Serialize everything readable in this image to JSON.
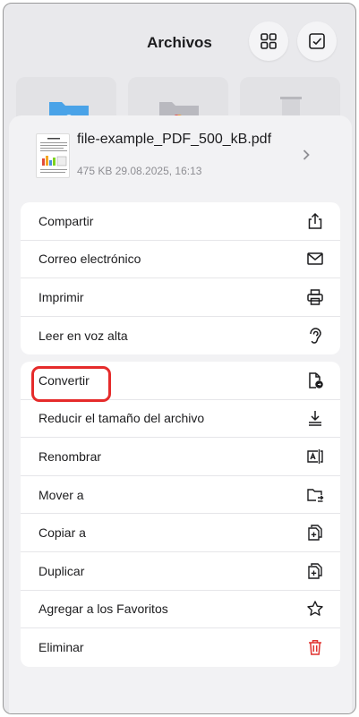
{
  "app": {
    "title": "Archivos"
  },
  "file": {
    "name": "file-example_PDF_500_kB.pdf",
    "meta": "475 KB 29.08.2025, 16:13"
  },
  "menu": {
    "group1": [
      {
        "label": "Compartir",
        "icon": "share-icon"
      },
      {
        "label": "Correo electrónico",
        "icon": "mail-icon"
      },
      {
        "label": "Imprimir",
        "icon": "printer-icon"
      },
      {
        "label": "Leer en voz alta",
        "icon": "ear-icon"
      }
    ],
    "group2": [
      {
        "label": "Convertir",
        "icon": "convert-icon"
      },
      {
        "label": "Reducir el tamaño del archivo",
        "icon": "compress-icon"
      },
      {
        "label": "Renombrar",
        "icon": "rename-icon"
      },
      {
        "label": "Mover a",
        "icon": "move-folder-icon"
      },
      {
        "label": "Copiar a",
        "icon": "copy-icon"
      },
      {
        "label": "Duplicar",
        "icon": "duplicate-icon"
      },
      {
        "label": "Agregar a los Favoritos",
        "icon": "star-icon"
      },
      {
        "label": "Eliminar",
        "icon": "trash-icon"
      }
    ]
  },
  "colors": {
    "highlight": "#e52b2b",
    "delete": "#e0322f"
  }
}
